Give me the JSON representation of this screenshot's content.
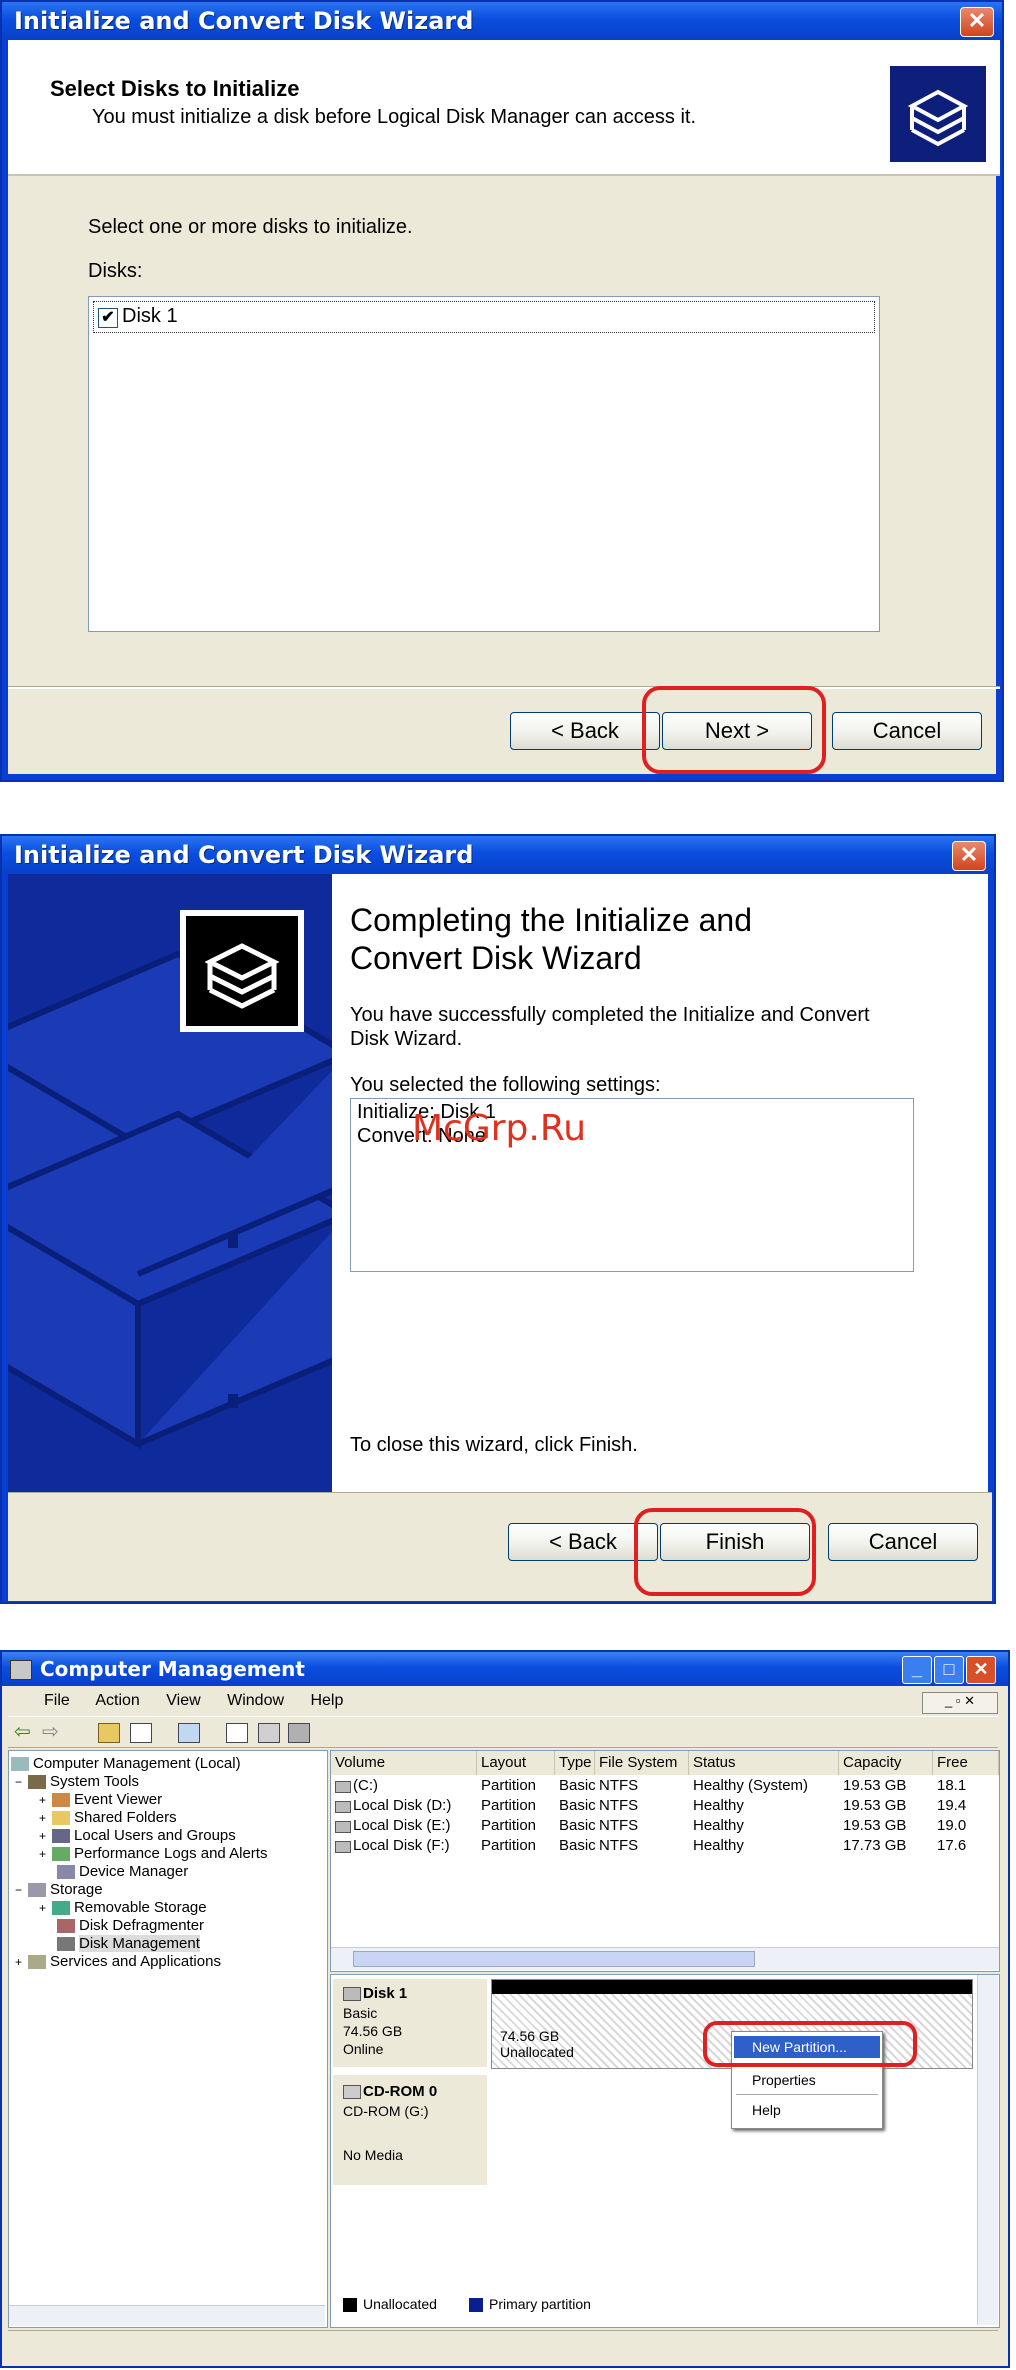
{
  "wizard1": {
    "title": "Initialize and Convert Disk Wizard",
    "close_glyph": "✕",
    "heading": "Select Disks to Initialize",
    "subheading": "You must initialize a disk before Logical Disk Manager can access it.",
    "instruction": "Select one or more disks to initialize.",
    "disks_label": "Disks:",
    "disks": [
      {
        "label": "Disk 1",
        "checked": true,
        "check_glyph": "✔"
      }
    ],
    "buttons": {
      "back": "< Back",
      "next": "Next >",
      "cancel": "Cancel"
    },
    "highlighted_button": "next"
  },
  "wizard2": {
    "title": "Initialize and Convert Disk Wizard",
    "close_glyph": "✕",
    "heading_line1": "Completing the Initialize and",
    "heading_line2": "Convert Disk Wizard",
    "success_line1": "You have successfully completed the Initialize and Convert",
    "success_line2": "Disk Wizard.",
    "settings_label": "You selected the following settings:",
    "settings": [
      "Initialize: Disk 1",
      "Convert: None"
    ],
    "close_hint": "To close this wizard, click Finish.",
    "watermark": "McGrp.Ru",
    "buttons": {
      "back": "< Back",
      "finish": "Finish",
      "cancel": "Cancel"
    },
    "highlighted_button": "finish"
  },
  "computer_management": {
    "title": "Computer Management",
    "window_buttons": {
      "minimize": "_",
      "maximize": "□",
      "close": "✕"
    },
    "menu": [
      "File",
      "Action",
      "View",
      "Window",
      "Help"
    ],
    "toolbar_glyphs": {
      "back": "⇦",
      "forward": "⇨"
    },
    "tree": [
      {
        "label": "Computer Management (Local)",
        "level": 0
      },
      {
        "label": "System Tools",
        "level": 1,
        "expander": "−"
      },
      {
        "label": "Event Viewer",
        "level": 2,
        "expander": "+"
      },
      {
        "label": "Shared Folders",
        "level": 2,
        "expander": "+"
      },
      {
        "label": "Local Users and Groups",
        "level": 2,
        "expander": "+"
      },
      {
        "label": "Performance Logs and Alerts",
        "level": 2,
        "expander": "+"
      },
      {
        "label": "Device Manager",
        "level": 2
      },
      {
        "label": "Storage",
        "level": 1,
        "expander": "−"
      },
      {
        "label": "Removable Storage",
        "level": 2,
        "expander": "+"
      },
      {
        "label": "Disk Defragmenter",
        "level": 2
      },
      {
        "label": "Disk Management",
        "level": 2,
        "selected": true
      },
      {
        "label": "Services and Applications",
        "level": 1,
        "expander": "+"
      }
    ],
    "columns": [
      "Volume",
      "Layout",
      "Type",
      "File System",
      "Status",
      "Capacity",
      "Free"
    ],
    "volumes": [
      {
        "volume": "(C:)",
        "layout": "Partition",
        "type": "Basic",
        "fs": "NTFS",
        "status": "Healthy (System)",
        "capacity": "19.53 GB",
        "free": "18.1"
      },
      {
        "volume": "Local Disk (D:)",
        "layout": "Partition",
        "type": "Basic",
        "fs": "NTFS",
        "status": "Healthy",
        "capacity": "19.53 GB",
        "free": "19.4"
      },
      {
        "volume": "Local Disk (E:)",
        "layout": "Partition",
        "type": "Basic",
        "fs": "NTFS",
        "status": "Healthy",
        "capacity": "19.53 GB",
        "free": "19.0"
      },
      {
        "volume": "Local Disk (F:)",
        "layout": "Partition",
        "type": "Basic",
        "fs": "NTFS",
        "status": "Healthy",
        "capacity": "17.73 GB",
        "free": "17.6"
      }
    ],
    "disk1": {
      "name": "Disk 1",
      "kind": "Basic",
      "size": "74.56 GB",
      "state": "Online",
      "region_size": "74.56 GB",
      "region_state": "Unallocated"
    },
    "cdrom": {
      "name": "CD-ROM 0",
      "device": "CD-ROM (G:)",
      "media": "No Media"
    },
    "context_menu": [
      "New Partition...",
      "Properties",
      "Help"
    ],
    "highlighted_menu_item": "New Partition...",
    "legend": [
      "Unallocated",
      "Primary partition"
    ],
    "colors": {
      "unallocated": "#000000",
      "primary_partition": "#0a1f8f",
      "xp_blue": "#0a4ee0"
    }
  }
}
